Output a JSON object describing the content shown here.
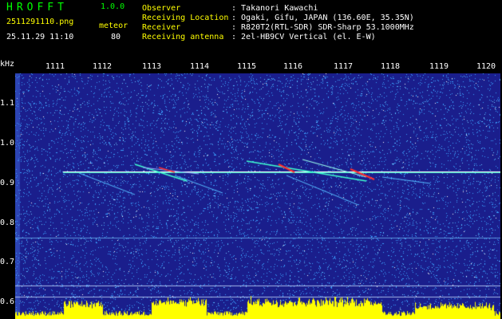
{
  "app": {
    "logo": "HROFFT",
    "version": "1.0.0",
    "filename": "2511291110.png",
    "datetime": "25.11.29 11:10",
    "mode_label": "meteor",
    "count": "80"
  },
  "meta": [
    {
      "key": "Observer",
      "value": ": Takanori Kawachi"
    },
    {
      "key": "Receiving Location",
      "value": ": Ogaki, Gifu, JAPAN (136.60E, 35.35N)"
    },
    {
      "key": "Receiver",
      "value": ": R820T2(RTL-SDR) SDR-Sharp 53.1000MHz"
    },
    {
      "key": "Receiving antenna",
      "value": ": 2el-HB9CV Vertical (el. E-W)"
    }
  ],
  "y_axis": {
    "unit": "kHz",
    "ticks": [
      "1.1",
      "1.0",
      "0.9",
      "0.8",
      "0.7",
      "0.6"
    ]
  },
  "x_axis": {
    "ticks": [
      "1111",
      "1112",
      "1113",
      "1114",
      "1115",
      "1116",
      "1117",
      "1118",
      "1119",
      "1120"
    ]
  },
  "colors": {
    "background": "#1a1e8c",
    "noise": "#3aa0ff",
    "trace": "#40ffd0",
    "hot": "#ff3030",
    "histogram": "#ffff00",
    "label_yellow": "#ffff00",
    "logo_green": "#00ff00"
  }
}
